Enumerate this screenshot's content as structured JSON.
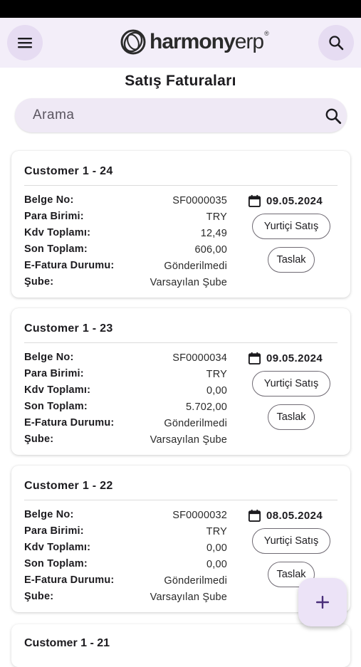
{
  "app": {
    "logo_bold": "harmony",
    "logo_light": "erp",
    "logo_tm": "®"
  },
  "page": {
    "title": "Satış Faturaları"
  },
  "search": {
    "placeholder": "Arama"
  },
  "labels": {
    "doc_no": "Belge No:",
    "currency": "Para Birimi:",
    "vat_total": "Kdv Toplamı:",
    "grand_total": "Son Toplam:",
    "einvoice_status": "E-Fatura Durumu:",
    "branch": "Şube:"
  },
  "invoices": [
    {
      "customer": "Customer 1 - 24",
      "doc_no": "SF0000035",
      "currency": "TRY",
      "vat_total": "12,49",
      "grand_total": "606,00",
      "einvoice_status": "Gönderilmedi",
      "branch": "Varsayılan Şube",
      "date": "09.05.2024",
      "type": "Yurtiçi Satış",
      "status": "Taslak"
    },
    {
      "customer": "Customer 1 - 23",
      "doc_no": "SF0000034",
      "currency": "TRY",
      "vat_total": "0,00",
      "grand_total": "5.702,00",
      "einvoice_status": "Gönderilmedi",
      "branch": "Varsayılan Şube",
      "date": "09.05.2024",
      "type": "Yurtiçi Satış",
      "status": "Taslak"
    },
    {
      "customer": "Customer 1 - 22",
      "doc_no": "SF0000032",
      "currency": "TRY",
      "vat_total": "0,00",
      "grand_total": "0,00",
      "einvoice_status": "Gönderilmedi",
      "branch": "Varsayılan Şube",
      "date": "08.05.2024",
      "type": "Yurtiçi Satış",
      "status": "Taslak"
    },
    {
      "customer": "Customer 1 - 21"
    }
  ],
  "icons": {
    "menu": "menu-icon",
    "search": "search-icon",
    "calendar": "calendar-icon",
    "add": "plus-icon"
  },
  "colors": {
    "appbar_bg": "#f3eef9",
    "accent": "#4a2f7a",
    "chip_border": "#6f6a73"
  }
}
